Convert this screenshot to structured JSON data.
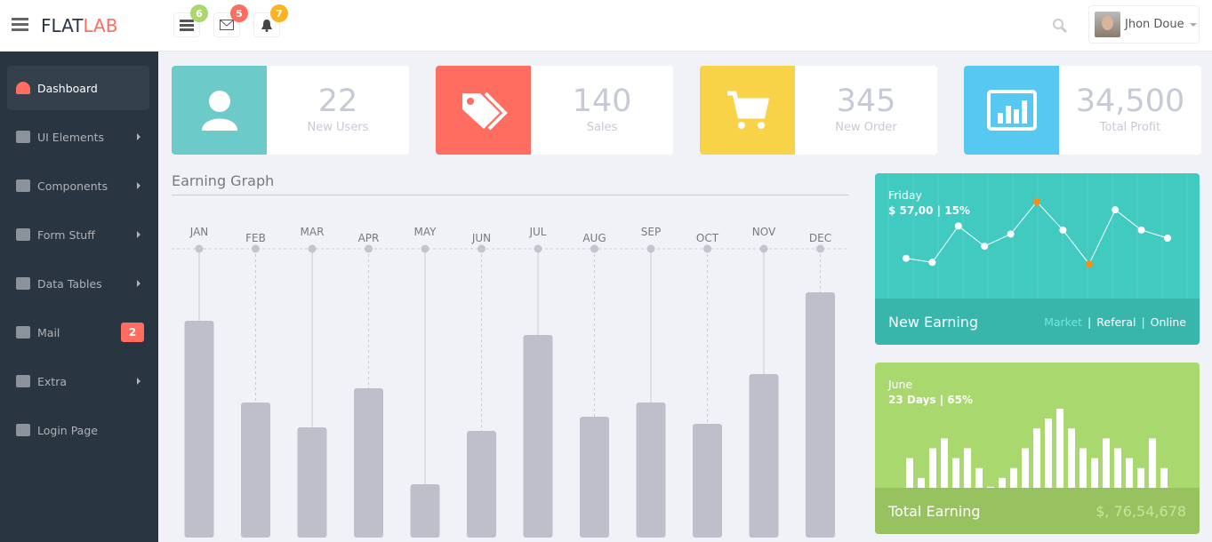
{
  "header": {
    "logo_a": "FLAT",
    "logo_b": "LAB",
    "notifications": [
      {
        "icon": "tasks-icon",
        "count": "6",
        "color": "#a9d86e"
      },
      {
        "icon": "envelope-icon",
        "count": "5",
        "color": "#ff6c60"
      },
      {
        "icon": "bell-icon",
        "count": "7",
        "color": "#fcb322"
      }
    ],
    "user_name": "Jhon Doue"
  },
  "sidebar": {
    "items": [
      {
        "label": "Dashboard",
        "icon": "dashboard-icon",
        "active": true
      },
      {
        "label": "UI Elements",
        "icon": "book-icon",
        "arrow": true
      },
      {
        "label": "Components",
        "icon": "cogs-icon",
        "arrow": true
      },
      {
        "label": "Form Stuff",
        "icon": "tasks-icon",
        "arrow": true
      },
      {
        "label": "Data Tables",
        "icon": "grid-icon",
        "arrow": true
      },
      {
        "label": "Mail",
        "icon": "envelope-icon",
        "badge": "2"
      },
      {
        "label": "Extra",
        "icon": "glass-icon",
        "arrow": true
      },
      {
        "label": "Login Page",
        "icon": "user-icon"
      }
    ]
  },
  "stats": [
    {
      "value": "22",
      "label": "New Users",
      "color": "#6ccac9",
      "icon": "user-icon"
    },
    {
      "value": "140",
      "label": "Sales",
      "color": "#ff6c60",
      "icon": "tags-icon"
    },
    {
      "value": "345",
      "label": "New Order",
      "color": "#f8d347",
      "icon": "cart-icon"
    },
    {
      "value": "34,500",
      "label": "Total Profit",
      "color": "#57c8f2",
      "icon": "bar-chart-icon"
    }
  ],
  "earning_graph": {
    "title": "Earning Graph"
  },
  "new_earning": {
    "day": "Friday",
    "summary": "$ 57,00 | 15%",
    "title": "New Earning",
    "links": [
      "Market",
      "Referal",
      "Online"
    ],
    "active_link_color": "#6ee6e0"
  },
  "total_earning": {
    "month": "June",
    "summary": "23 Days | 65%",
    "title": "Total Earning",
    "amount": "$, 76,54,678"
  },
  "chart_data": [
    {
      "type": "bar",
      "categories": [
        "JAN",
        "FEB",
        "MAR",
        "APR",
        "MAY",
        "JUN",
        "JUL",
        "AUG",
        "SEP",
        "OCT",
        "NOV",
        "DEC"
      ],
      "values": [
        61,
        38,
        31,
        42,
        15,
        30,
        57,
        34,
        38,
        32,
        46,
        69
      ],
      "ylim": [
        0,
        100
      ],
      "color": "#bfbfcb"
    },
    {
      "type": "line",
      "values": [
        3,
        2.5,
        7,
        4.5,
        6,
        10,
        6.5,
        2.3,
        9,
        6.5,
        5.5
      ],
      "highlight_indices": [
        5,
        7
      ],
      "highlight_color": "#fa8c13",
      "ylim": [
        0,
        11
      ]
    },
    {
      "type": "bar",
      "values": [
        3,
        1,
        4,
        5,
        3,
        4,
        2,
        0.1,
        1,
        2,
        4,
        6,
        7,
        8,
        6,
        4,
        3,
        5,
        4,
        3,
        2,
        5,
        2
      ],
      "ylim": [
        0,
        8
      ]
    }
  ]
}
